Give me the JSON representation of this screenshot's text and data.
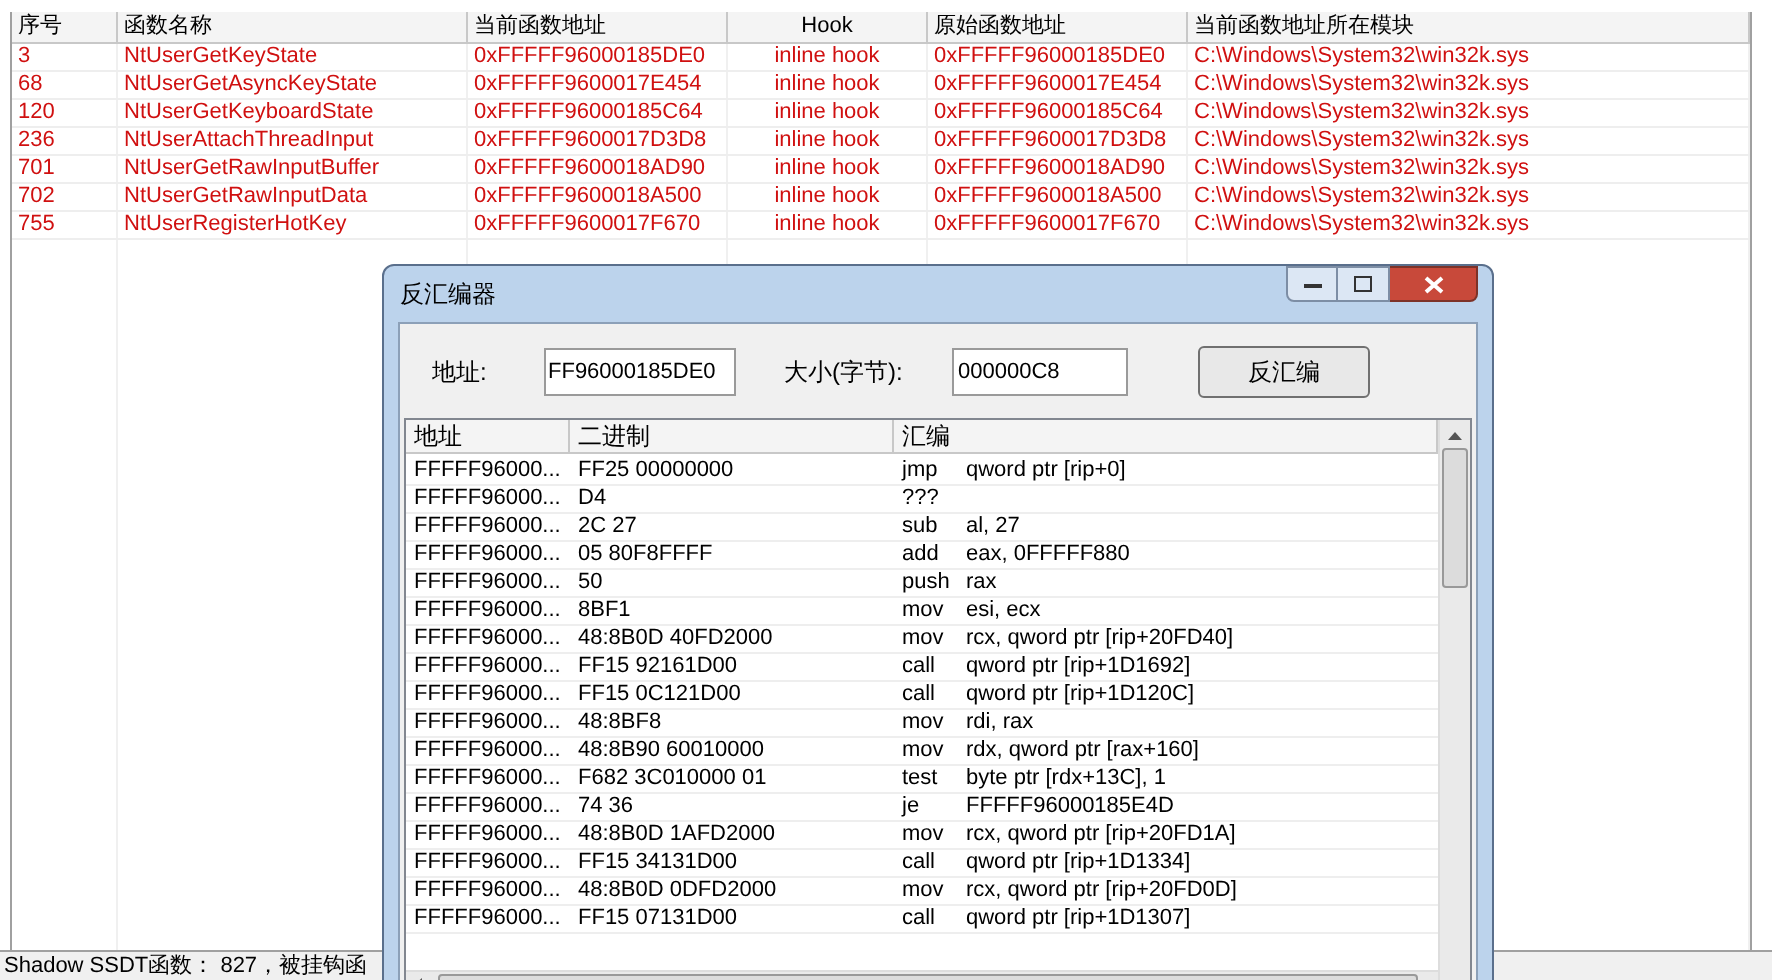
{
  "table": {
    "columns": [
      "序号",
      "函数名称",
      "当前函数地址",
      "Hook",
      "原始函数地址",
      "当前函数地址所在模块"
    ],
    "rows": [
      [
        "3",
        "NtUserGetKeyState",
        "0xFFFFF96000185DE0",
        "inline hook",
        "0xFFFFF96000185DE0",
        "C:\\Windows\\System32\\win32k.sys"
      ],
      [
        "68",
        "NtUserGetAsyncKeyState",
        "0xFFFFF9600017E454",
        "inline hook",
        "0xFFFFF9600017E454",
        "C:\\Windows\\System32\\win32k.sys"
      ],
      [
        "120",
        "NtUserGetKeyboardState",
        "0xFFFFF96000185C64",
        "inline hook",
        "0xFFFFF96000185C64",
        "C:\\Windows\\System32\\win32k.sys"
      ],
      [
        "236",
        "NtUserAttachThreadInput",
        "0xFFFFF9600017D3D8",
        "inline hook",
        "0xFFFFF9600017D3D8",
        "C:\\Windows\\System32\\win32k.sys"
      ],
      [
        "701",
        "NtUserGetRawInputBuffer",
        "0xFFFFF9600018AD90",
        "inline hook",
        "0xFFFFF9600018AD90",
        "C:\\Windows\\System32\\win32k.sys"
      ],
      [
        "702",
        "NtUserGetRawInputData",
        "0xFFFFF9600018A500",
        "inline hook",
        "0xFFFFF9600018A500",
        "C:\\Windows\\System32\\win32k.sys"
      ],
      [
        "755",
        "NtUserRegisterHotKey",
        "0xFFFFF9600017F670",
        "inline hook",
        "0xFFFFF9600017F670",
        "C:\\Windows\\System32\\win32k.sys"
      ]
    ]
  },
  "status_bar": "Shadow SSDT函数： 827，被挂钩函",
  "dialog": {
    "title": "反汇编器",
    "address_label": "地址:",
    "address_value": "FF96000185DE0",
    "size_label": "大小(字节):",
    "size_value": "000000C8",
    "button": "反汇编",
    "columns": [
      "地址",
      "二进制",
      "汇编"
    ],
    "rows": [
      [
        "FFFFF96000...",
        "FF25 00000000",
        "jmp",
        "qword ptr [rip+0]"
      ],
      [
        "FFFFF96000...",
        "D4",
        "???",
        ""
      ],
      [
        "FFFFF96000...",
        "2C 27",
        "sub",
        "al, 27"
      ],
      [
        "FFFFF96000...",
        "05 80F8FFFF",
        "add",
        "eax, 0FFFFF880"
      ],
      [
        "FFFFF96000...",
        "50",
        "push",
        "rax"
      ],
      [
        "FFFFF96000...",
        "8BF1",
        "mov",
        "esi, ecx"
      ],
      [
        "FFFFF96000...",
        "48:8B0D 40FD2000",
        "mov",
        "rcx, qword ptr [rip+20FD40]"
      ],
      [
        "FFFFF96000...",
        "FF15 92161D00",
        "call",
        "qword ptr [rip+1D1692]"
      ],
      [
        "FFFFF96000...",
        "FF15 0C121D00",
        "call",
        "qword ptr [rip+1D120C]"
      ],
      [
        "FFFFF96000...",
        "48:8BF8",
        "mov",
        "rdi, rax"
      ],
      [
        "FFFFF96000...",
        "48:8B90 60010000",
        "mov",
        "rdx, qword ptr [rax+160]"
      ],
      [
        "FFFFF96000...",
        "F682 3C010000 01",
        "test",
        "byte ptr [rdx+13C], 1"
      ],
      [
        "FFFFF96000...",
        "74 36",
        "je",
        "FFFFF96000185E4D"
      ],
      [
        "FFFFF96000...",
        "48:8B0D 1AFD2000",
        "mov",
        "rcx, qword ptr [rip+20FD1A]"
      ],
      [
        "FFFFF96000...",
        "FF15 34131D00",
        "call",
        "qword ptr [rip+1D1334]"
      ],
      [
        "FFFFF96000...",
        "48:8B0D 0DFD2000",
        "mov",
        "rcx, qword ptr [rip+20FD0D]"
      ],
      [
        "FFFFF96000...",
        "FF15 07131D00",
        "call",
        "qword ptr [rip+1D1307]"
      ]
    ]
  }
}
